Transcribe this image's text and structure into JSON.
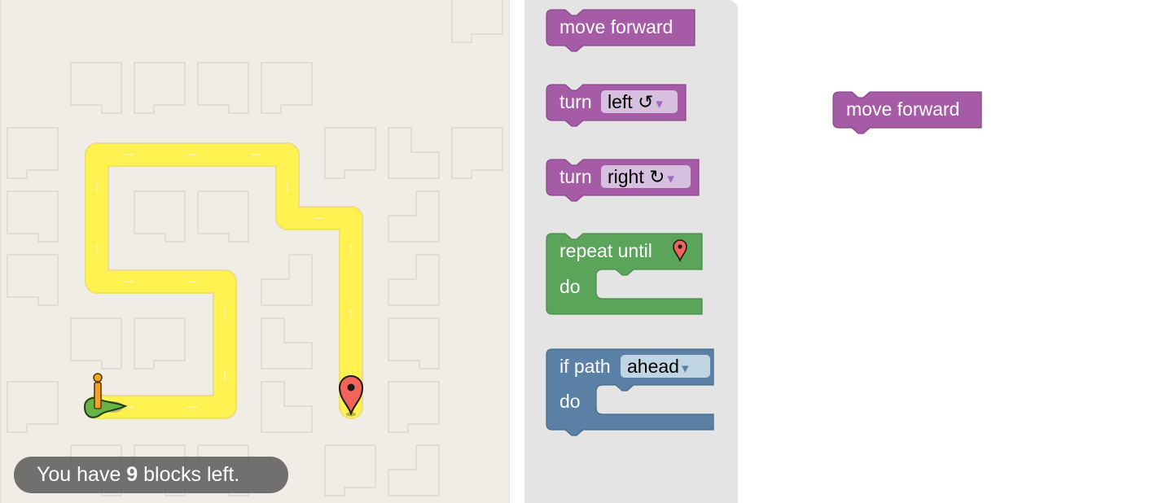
{
  "maze": {
    "blocks_left_prefix": "You have ",
    "blocks_left_count": "9",
    "blocks_left_suffix": " blocks left."
  },
  "toolbox": {
    "move_forward": "move forward",
    "turn_left": {
      "label": "turn",
      "option": "left ↺",
      "arrow": "▾"
    },
    "turn_right": {
      "label": "turn",
      "option": "right ↻",
      "arrow": "▾"
    },
    "repeat_until": {
      "label": "repeat until",
      "do": "do",
      "icon": "pin-marker-icon"
    },
    "if_path": {
      "label": "if path",
      "option": "ahead",
      "arrow": "▾",
      "do": "do"
    }
  },
  "workspace": {
    "move_forward": "move forward"
  },
  "colors": {
    "motion_block": "#a55ba5",
    "loop_block": "#5ba55b",
    "logic_block": "#5b80a5",
    "path": "#fff14f",
    "maze_bg": "#f0ede6"
  }
}
